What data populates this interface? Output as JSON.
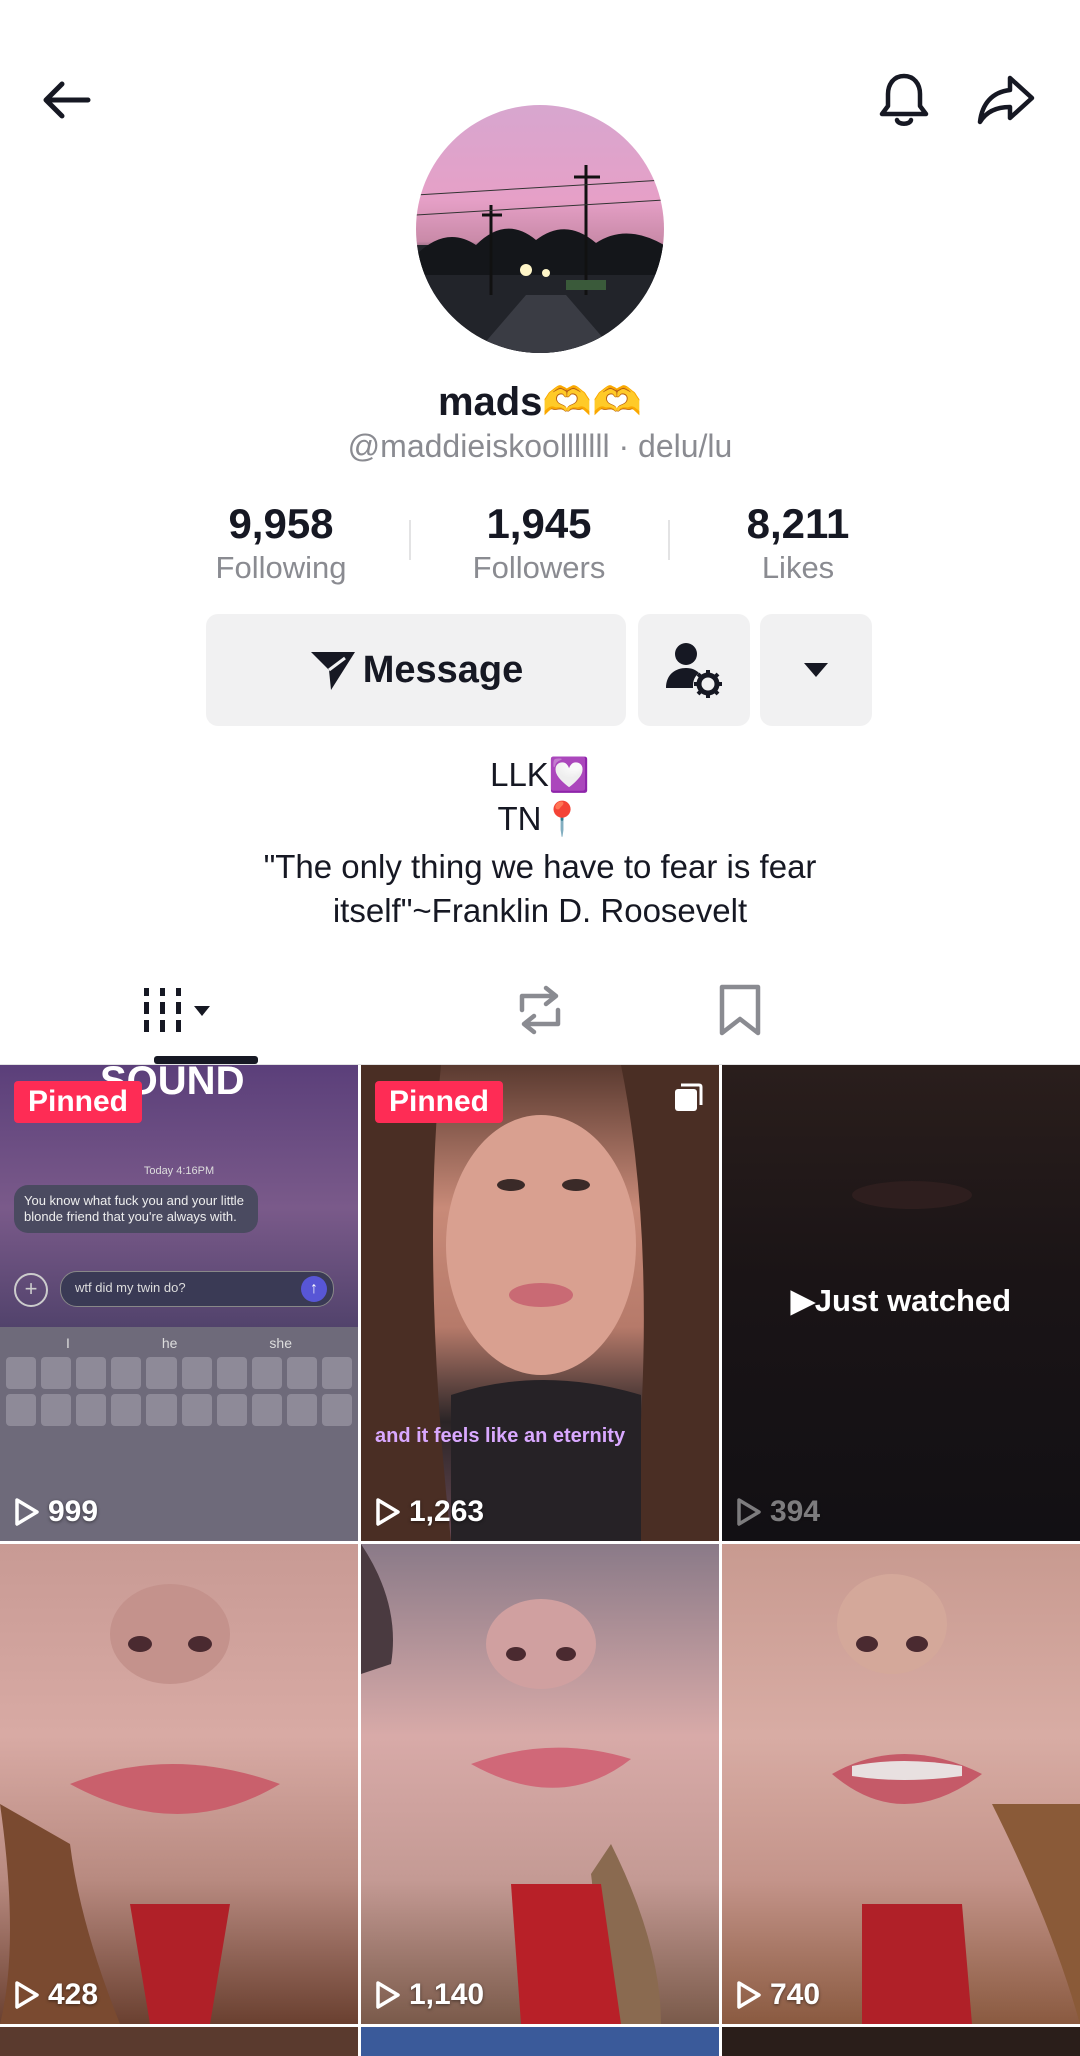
{
  "profile": {
    "display_name": "mads🫶🫶",
    "username_line": "@maddieiskoolllllll · delu/lu",
    "stats": [
      {
        "value": "9,958",
        "label": "Following"
      },
      {
        "value": "1,945",
        "label": "Followers"
      },
      {
        "value": "8,211",
        "label": "Likes"
      }
    ],
    "message_label": "Message",
    "bio": [
      "LLK💟",
      "TN📍",
      "\"The only thing we have to fear is fear",
      "itself\"~Franklin D. Roosevelt"
    ]
  },
  "header": {
    "icons": [
      "back-arrow-icon",
      "bell-icon",
      "share-icon"
    ]
  },
  "tabs": [
    "videos-tab",
    "reposts-tab",
    "favorites-tab"
  ],
  "videos": [
    {
      "badge": "Pinned",
      "views": "999",
      "overlay_top": "SOUND",
      "chat": {
        "time": "Today 4:16PM",
        "message": "You know what fuck you and your little blonde friend that you're always with.",
        "input": "wtf did my twin do?",
        "suggestions": [
          "I",
          "he",
          "she"
        ]
      }
    },
    {
      "badge": "Pinned",
      "views": "1,263",
      "caption": "and it feels like an eternity"
    },
    {
      "overlay": "Just watched",
      "views": "394"
    },
    {
      "views": "428"
    },
    {
      "views": "1,140"
    },
    {
      "views": "740"
    }
  ],
  "colors": {
    "pinned_bg": "#fe2c55",
    "text": "#161823",
    "muted": "#8a8b91",
    "button_bg": "#f1f1f2"
  }
}
